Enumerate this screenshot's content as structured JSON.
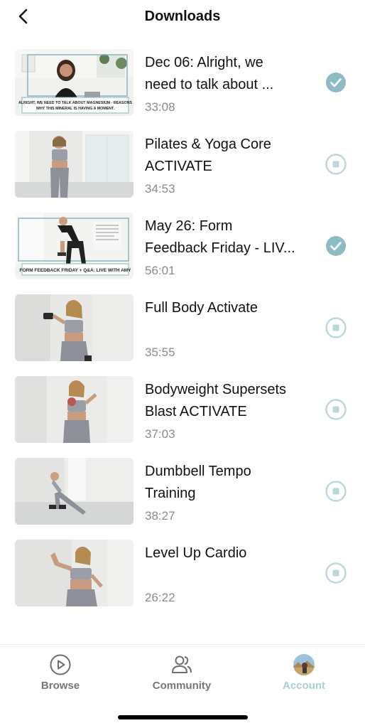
{
  "header": {
    "title": "Downloads",
    "back_icon": "chevron-left-icon"
  },
  "colors": {
    "accent": "#7fb6c0",
    "accent_light": "#a8cfd5",
    "muted": "#8a8a8a"
  },
  "downloads": [
    {
      "title_line1": "Dec 06: Alright, we",
      "title_line2": "need to talk about ...",
      "duration": "33:08",
      "status": "downloaded",
      "thumb_caption_1": "ALRIGHT, WE NEED TO TALK ABOUT MAGNESIUM - REASONS",
      "thumb_caption_2": "WHY THIS MINERAL IS HAVING A MOMENT."
    },
    {
      "title_line1": "Pilates & Yoga Core",
      "title_line2": "ACTIVATE",
      "duration": "34:53",
      "status": "not-downloaded"
    },
    {
      "title_line1": "May 26: Form",
      "title_line2": "Feedback Friday - LIV...",
      "duration": "56:01",
      "status": "downloaded",
      "thumb_caption_1": "FORM FEEDBACK FRIDAY + Q&A: LIVE WITH AMY"
    },
    {
      "title_line1": "Full Body Activate",
      "title_line2": "",
      "duration": "35:55",
      "status": "not-downloaded"
    },
    {
      "title_line1": "Bodyweight Supersets",
      "title_line2": "Blast ACTIVATE",
      "duration": "37:03",
      "status": "not-downloaded"
    },
    {
      "title_line1": "Dumbbell Tempo",
      "title_line2": "Training",
      "duration": "38:27",
      "status": "not-downloaded"
    },
    {
      "title_line1": "Level Up Cardio",
      "title_line2": "",
      "duration": "26:22",
      "status": "not-downloaded"
    }
  ],
  "tabbar": {
    "tabs": [
      {
        "label": "Browse",
        "icon": "play-circle-icon",
        "active": false
      },
      {
        "label": "Community",
        "icon": "users-icon",
        "active": false
      },
      {
        "label": "Account",
        "icon": "avatar-photo",
        "active": true
      }
    ]
  }
}
